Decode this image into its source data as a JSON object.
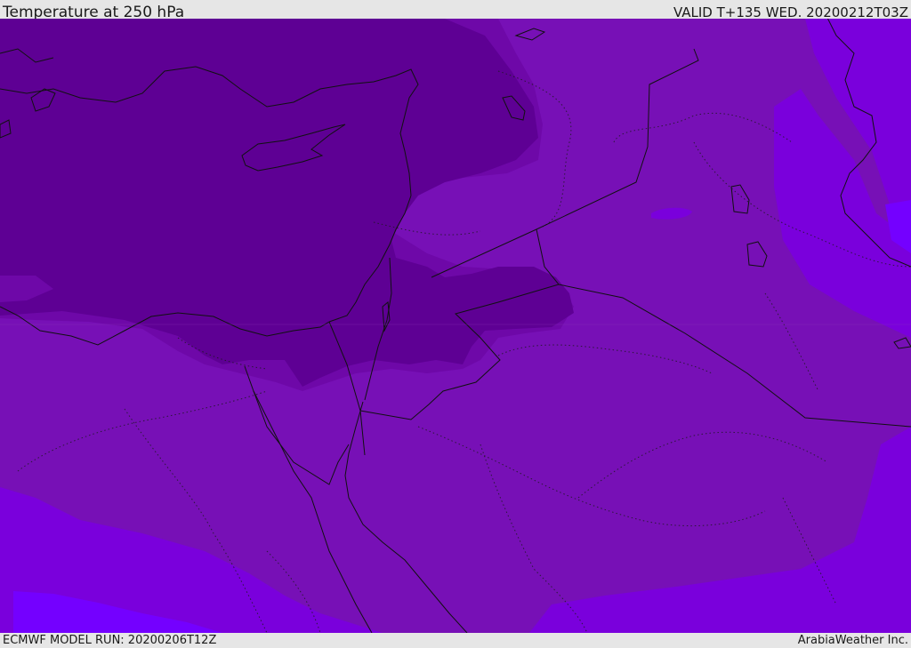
{
  "header": {
    "title": "Temperature at 250 hPa",
    "valid": "VALID T+135 WED. 20200212T03Z"
  },
  "footer": {
    "model_run": "ECMWF MODEL RUN: 20200206T12Z",
    "credit": "ArabiaWeather Inc."
  },
  "colors": {
    "coldest": "#5e0094",
    "cold": "#6e08a8",
    "mid": "#7710b6",
    "warm": "#7a00dc",
    "warmest": "#7400ff",
    "borders": "#111111",
    "header_bg": "#e6e6e6"
  }
}
